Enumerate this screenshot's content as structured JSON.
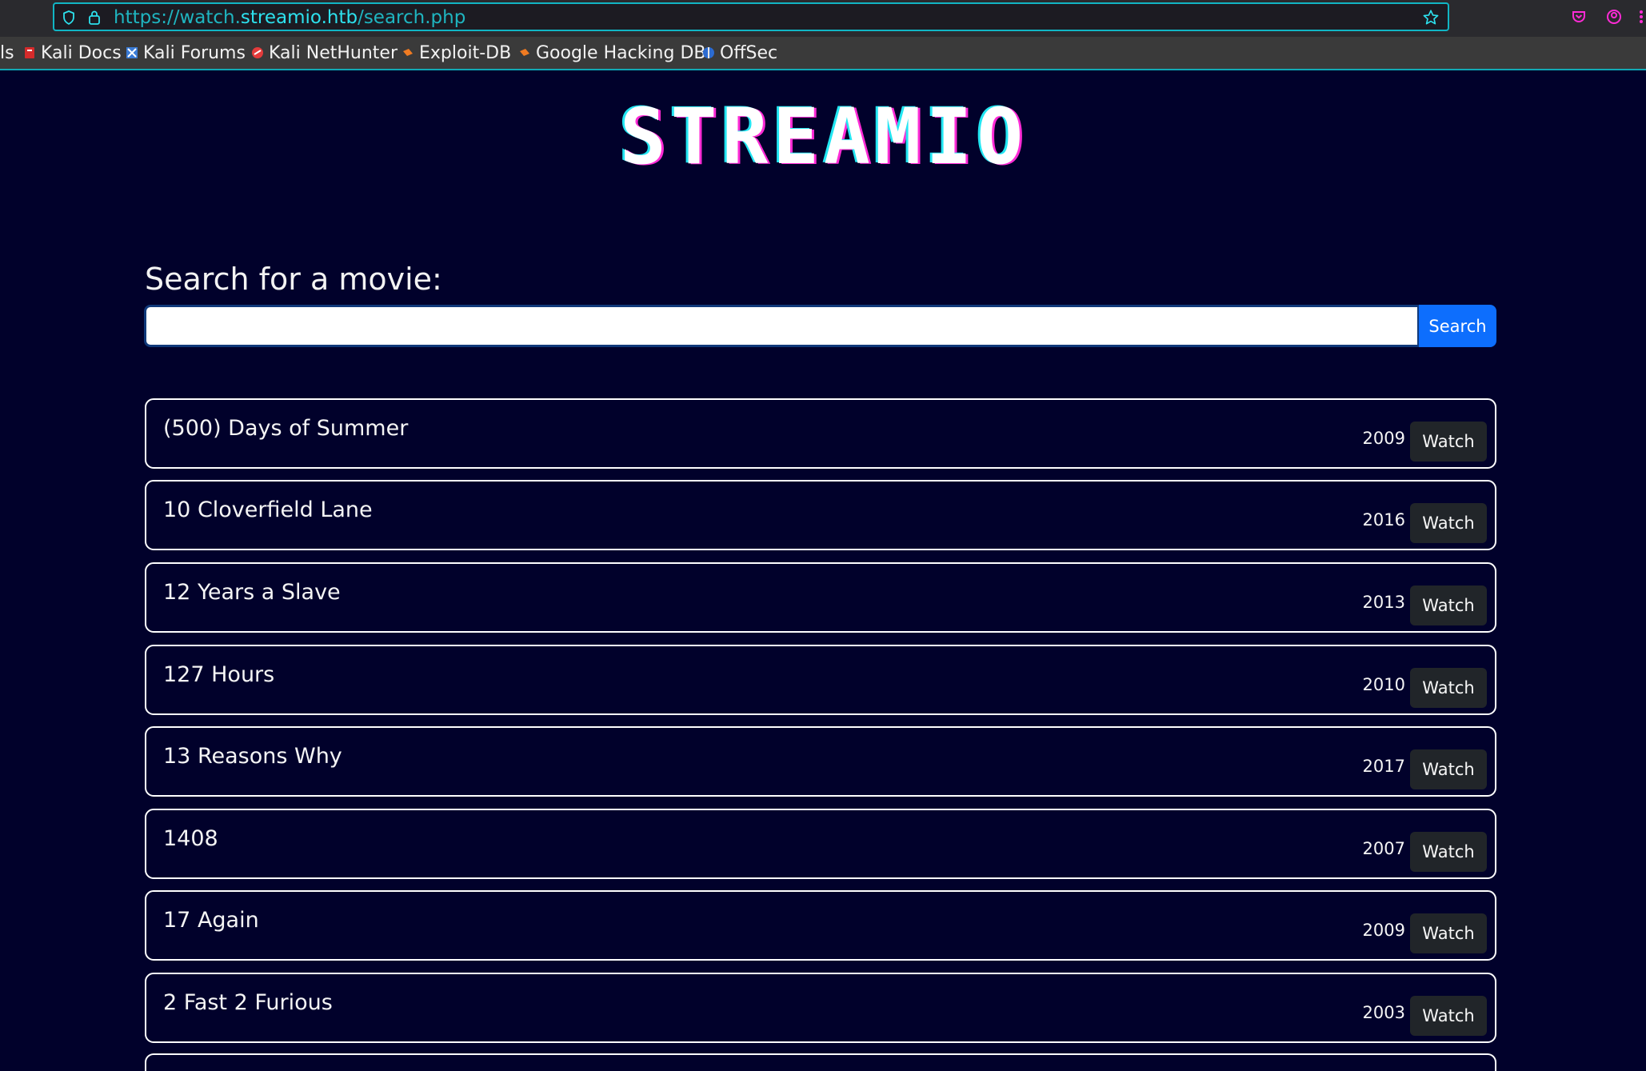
{
  "browser": {
    "url_prefix": "https://watch.",
    "url_domain": "streamio.htb",
    "url_path": "/search.php",
    "bookmarks": [
      {
        "label": "ls",
        "icon": "partial-icon"
      },
      {
        "label": "Kali Docs",
        "icon": "kali-docs-icon"
      },
      {
        "label": "Kali Forums",
        "icon": "kali-forums-icon"
      },
      {
        "label": "Kali NetHunter",
        "icon": "kali-nethunter-icon"
      },
      {
        "label": "Exploit-DB",
        "icon": "exploit-db-icon"
      },
      {
        "label": "Google Hacking DB",
        "icon": "ghdb-icon"
      },
      {
        "label": "OffSec",
        "icon": "offsec-icon"
      }
    ]
  },
  "page": {
    "logo_text": "STREAMIO",
    "search_heading": "Search for a movie:",
    "search_value": "",
    "search_button": "Search",
    "movies": [
      {
        "title": "(500) Days of Summer",
        "year": "2009",
        "action": "Watch"
      },
      {
        "title": "10 Cloverfield Lane",
        "year": "2016",
        "action": "Watch"
      },
      {
        "title": "12 Years a Slave",
        "year": "2013",
        "action": "Watch"
      },
      {
        "title": "127 Hours",
        "year": "2010",
        "action": "Watch"
      },
      {
        "title": "13 Reasons Why",
        "year": "2017",
        "action": "Watch"
      },
      {
        "title": "1408",
        "year": "2007",
        "action": "Watch"
      },
      {
        "title": "17 Again",
        "year": "2009",
        "action": "Watch"
      },
      {
        "title": "2 Fast 2 Furious",
        "year": "2003",
        "action": "Watch"
      }
    ]
  },
  "colors": {
    "page_bg": "#01012b",
    "accent_cyan": "#11b5c4",
    "logo_magenta": "#ff2bd6",
    "search_blue": "#0d6efd"
  }
}
